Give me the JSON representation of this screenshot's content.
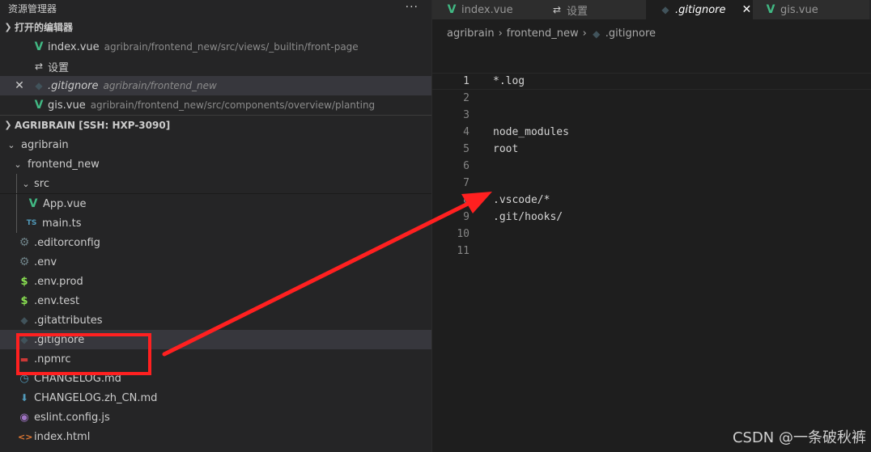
{
  "sidebar": {
    "title": "资源管理器",
    "more_icon": "ellipsis-icon",
    "open_editors": {
      "header": "打开的编辑器",
      "items": [
        {
          "name": "index.vue",
          "path": "agribrain/frontend_new/src/views/_builtin/front-page",
          "icon": "vue-icon"
        },
        {
          "name": "设置",
          "path": "",
          "icon": "settings-sliders-icon"
        },
        {
          "name": ".gitignore",
          "path": "agribrain/frontend_new",
          "icon": "git-icon",
          "selected": true
        },
        {
          "name": "gis.vue",
          "path": "agribrain/frontend_new/src/components/overview/planting",
          "icon": "vue-icon"
        }
      ]
    },
    "workspace": {
      "header": "AGRIBRAIN [SSH: HXP-3090]",
      "tree": [
        {
          "name": "agribrain",
          "type": "folder"
        },
        {
          "name": "frontend_new",
          "type": "folder"
        },
        {
          "name": "src",
          "type": "folder"
        },
        {
          "name": "App.vue",
          "icon": "vue-icon"
        },
        {
          "name": "main.ts",
          "icon": "ts-icon"
        },
        {
          "name": ".editorconfig",
          "icon": "gear-icon"
        },
        {
          "name": ".env",
          "icon": "gear-icon"
        },
        {
          "name": ".env.prod",
          "icon": "dollar-icon"
        },
        {
          "name": ".env.test",
          "icon": "dollar-icon"
        },
        {
          "name": ".gitattributes",
          "icon": "git-icon"
        },
        {
          "name": ".gitignore",
          "icon": "git-icon",
          "selected": true
        },
        {
          "name": ".npmrc",
          "icon": "npm-icon"
        },
        {
          "name": "CHANGELOG.md",
          "icon": "clock-icon"
        },
        {
          "name": "CHANGELOG.zh_CN.md",
          "icon": "down-arrow-icon"
        },
        {
          "name": "eslint.config.js",
          "icon": "eslint-icon"
        },
        {
          "name": "index.html",
          "icon": "html-icon"
        }
      ]
    }
  },
  "tabs": [
    {
      "label": "index.vue",
      "icon": "vue-icon"
    },
    {
      "label": "设置",
      "icon": "settings-sliders-icon"
    },
    {
      "label": ".gitignore",
      "icon": "git-icon",
      "active": true
    },
    {
      "label": "gis.vue",
      "icon": "vue-icon"
    }
  ],
  "breadcrumb": [
    "agribrain",
    "frontend_new",
    ".gitignore"
  ],
  "editor": {
    "lines": [
      {
        "n": "1",
        "text": "*.log"
      },
      {
        "n": "2",
        "text": ""
      },
      {
        "n": "3",
        "text": ""
      },
      {
        "n": "4",
        "text": "node_modules"
      },
      {
        "n": "5",
        "text": "root"
      },
      {
        "n": "6",
        "text": ""
      },
      {
        "n": "7",
        "text": ""
      },
      {
        "n": "8",
        "text": ".vscode/*"
      },
      {
        "n": "9",
        "text": ".git/hooks/"
      },
      {
        "n": "10",
        "text": ""
      },
      {
        "n": "11",
        "text": ""
      }
    ]
  },
  "watermark": "CSDN @一条破秋裤",
  "colors": {
    "annotation": "#ff2020",
    "vue": "#41b883",
    "selection": "#37373d"
  }
}
